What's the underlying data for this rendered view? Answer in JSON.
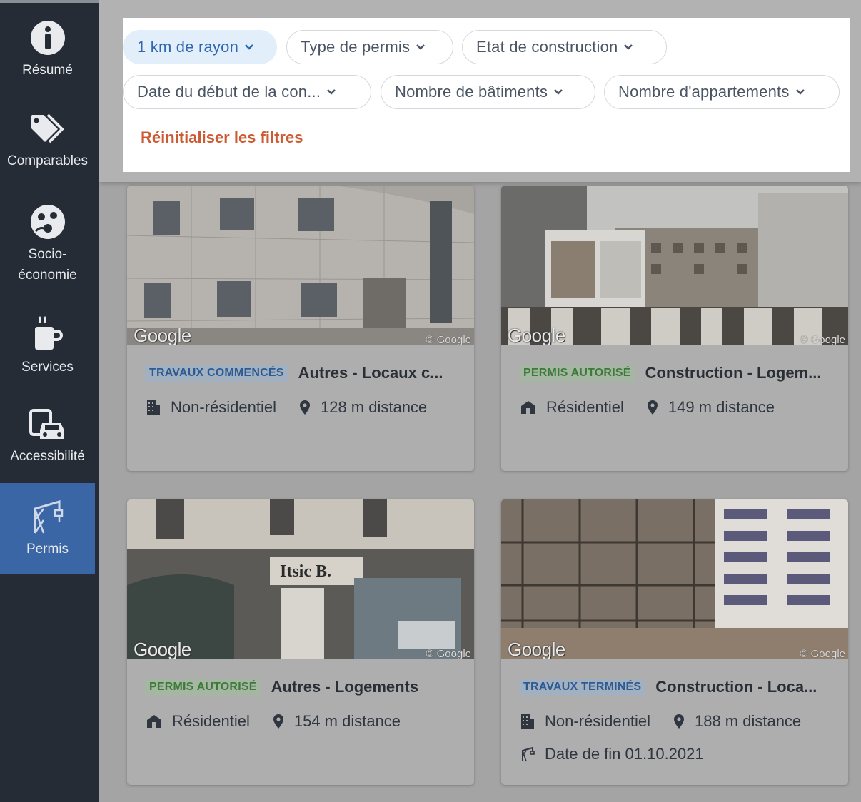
{
  "sidebar": {
    "items": [
      {
        "label": "Résumé",
        "icon": "info-icon"
      },
      {
        "label": "Comparables",
        "icon": "tags-icon"
      },
      {
        "label": "Socio-\néconomie",
        "icon": "socio-icon"
      },
      {
        "label": "Services",
        "icon": "coffee-icon"
      },
      {
        "label": "Accessibilité",
        "icon": "car-bus-icon"
      },
      {
        "label": "Permis",
        "icon": "crane-icon"
      }
    ],
    "active": "Permis"
  },
  "filters": {
    "radius": "1 km de rayon",
    "permit_type": "Type de permis",
    "construction_state": "Etat de construction",
    "start_date": "Date du début de la con...",
    "buildings": "Nombre de bâtiments",
    "apartments": "Nombre d'appartements",
    "reset": "Réinitialiser les filtres"
  },
  "cards": [
    {
      "status": "TRAVAUX COMMENCÉS",
      "status_color": "blue",
      "title": "Autres - Locaux c...",
      "type": "Non-résidentiel",
      "distance": "128 m distance"
    },
    {
      "status": "PERMIS AUTORISÉ",
      "status_color": "green",
      "title": "Construction - Logem...",
      "type": "Résidentiel",
      "distance": "149 m distance"
    },
    {
      "status": "PERMIS AUTORISÉ",
      "status_color": "green",
      "title": "Autres - Logements",
      "type": "Résidentiel",
      "distance": "154 m distance"
    },
    {
      "status": "TRAVAUX TERMINÉS",
      "status_color": "blue",
      "title": "Construction - Loca...",
      "type": "Non-résidentiel",
      "distance": "188 m distance",
      "end_date": "Date de fin 01.10.2021"
    }
  ],
  "photo": {
    "logo": "Google",
    "copyright": "© Google",
    "storefront_sign": "Itsic B."
  },
  "colors": {
    "sidebar_bg": "#262c35",
    "active_nav": "#3a66a6",
    "reset_text": "#cc5a32",
    "chip_active_bg": "#e3eefb"
  }
}
